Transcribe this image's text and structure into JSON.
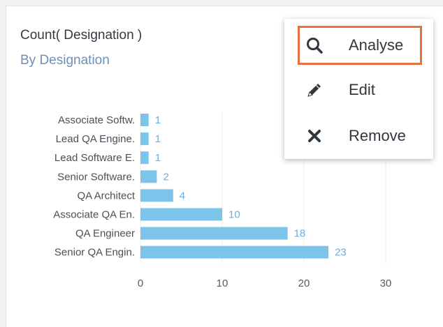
{
  "card": {
    "title": "Count( Designation )",
    "subtitle": "By Designation"
  },
  "menu": {
    "items": [
      {
        "label": "Analyse",
        "icon": "search-icon"
      },
      {
        "label": "Edit",
        "icon": "pencil-icon"
      },
      {
        "label": "Remove",
        "icon": "close-icon"
      }
    ]
  },
  "colors": {
    "bar": "#7cc4ea",
    "value_label": "#6aaee0",
    "highlight": "#e8703a"
  },
  "chart_data": {
    "type": "bar",
    "orientation": "horizontal",
    "categories": [
      "Associate Softw.",
      "Lead QA Engine.",
      "Lead Software E.",
      "Senior Software.",
      "QA Architect",
      "Associate QA En.",
      "QA Engineer",
      "Senior QA Engin."
    ],
    "values": [
      1,
      1,
      1,
      2,
      4,
      10,
      18,
      23
    ],
    "xlim": [
      0,
      30
    ],
    "xticks": [
      0,
      10,
      20,
      30
    ],
    "grid": true
  }
}
